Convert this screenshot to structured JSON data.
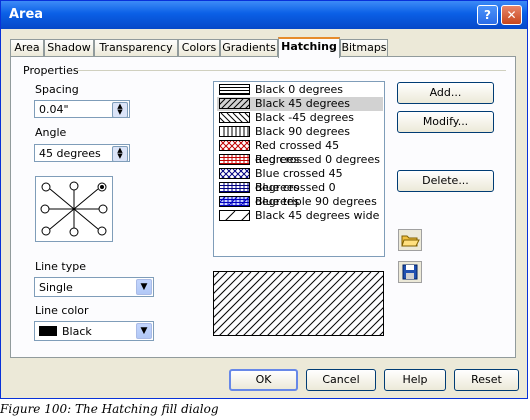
{
  "window": {
    "title": "Area",
    "help_glyph": "?",
    "close_glyph": "✕"
  },
  "tabs": [
    {
      "label": "Area"
    },
    {
      "label": "Shadow"
    },
    {
      "label": "Transparency"
    },
    {
      "label": "Colors"
    },
    {
      "label": "Gradients"
    },
    {
      "label": "Hatching"
    },
    {
      "label": "Bitmaps"
    }
  ],
  "properties": {
    "group_label": "Properties",
    "spacing_label": "Spacing",
    "spacing_value": "0.04\"",
    "angle_label": "Angle",
    "angle_value": "45 degrees",
    "line_type_label": "Line type",
    "line_type_value": "Single",
    "line_color_label": "Line color",
    "line_color_value": "Black",
    "line_color_hex": "#000000"
  },
  "hatch_list": [
    {
      "label": "Black 0 degrees",
      "pattern": "h0",
      "color": "#000000"
    },
    {
      "label": "Black 45 degrees",
      "pattern": "d45",
      "color": "#000000",
      "selected": true
    },
    {
      "label": "Black -45 degrees",
      "pattern": "dm45",
      "color": "#000000"
    },
    {
      "label": "Black 90 degrees",
      "pattern": "v90",
      "color": "#000000"
    },
    {
      "label": "Red crossed 45 degrees",
      "pattern": "x45",
      "color": "#c00000"
    },
    {
      "label": "Red crossed 0 degrees",
      "pattern": "x0",
      "color": "#c00000"
    },
    {
      "label": "Blue crossed 45 degrees",
      "pattern": "x45",
      "color": "#000080"
    },
    {
      "label": "Blue crossed 0 degrees",
      "pattern": "x0",
      "color": "#000080"
    },
    {
      "label": "Blue triple 90 degrees",
      "pattern": "triple",
      "color": "#0000c0"
    },
    {
      "label": "Black 45 degrees wide",
      "pattern": "wide",
      "color": "#000000"
    }
  ],
  "buttons": {
    "add": "Add...",
    "modify": "Modify...",
    "delete": "Delete...",
    "ok": "OK",
    "cancel": "Cancel",
    "help": "Help",
    "reset": "Reset"
  },
  "icons": {
    "load": "open-folder-icon",
    "save": "floppy-disk-icon"
  },
  "caption": "Figure 100: The Hatching fill dialog"
}
